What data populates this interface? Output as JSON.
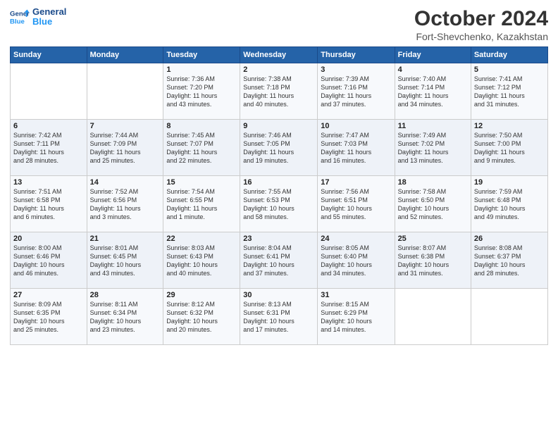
{
  "header": {
    "logo_line1": "General",
    "logo_line2": "Blue",
    "month_title": "October 2024",
    "location": "Fort-Shevchenko, Kazakhstan"
  },
  "weekdays": [
    "Sunday",
    "Monday",
    "Tuesday",
    "Wednesday",
    "Thursday",
    "Friday",
    "Saturday"
  ],
  "weeks": [
    [
      {
        "day": "",
        "info": ""
      },
      {
        "day": "",
        "info": ""
      },
      {
        "day": "1",
        "info": "Sunrise: 7:36 AM\nSunset: 7:20 PM\nDaylight: 11 hours\nand 43 minutes."
      },
      {
        "day": "2",
        "info": "Sunrise: 7:38 AM\nSunset: 7:18 PM\nDaylight: 11 hours\nand 40 minutes."
      },
      {
        "day": "3",
        "info": "Sunrise: 7:39 AM\nSunset: 7:16 PM\nDaylight: 11 hours\nand 37 minutes."
      },
      {
        "day": "4",
        "info": "Sunrise: 7:40 AM\nSunset: 7:14 PM\nDaylight: 11 hours\nand 34 minutes."
      },
      {
        "day": "5",
        "info": "Sunrise: 7:41 AM\nSunset: 7:12 PM\nDaylight: 11 hours\nand 31 minutes."
      }
    ],
    [
      {
        "day": "6",
        "info": "Sunrise: 7:42 AM\nSunset: 7:11 PM\nDaylight: 11 hours\nand 28 minutes."
      },
      {
        "day": "7",
        "info": "Sunrise: 7:44 AM\nSunset: 7:09 PM\nDaylight: 11 hours\nand 25 minutes."
      },
      {
        "day": "8",
        "info": "Sunrise: 7:45 AM\nSunset: 7:07 PM\nDaylight: 11 hours\nand 22 minutes."
      },
      {
        "day": "9",
        "info": "Sunrise: 7:46 AM\nSunset: 7:05 PM\nDaylight: 11 hours\nand 19 minutes."
      },
      {
        "day": "10",
        "info": "Sunrise: 7:47 AM\nSunset: 7:03 PM\nDaylight: 11 hours\nand 16 minutes."
      },
      {
        "day": "11",
        "info": "Sunrise: 7:49 AM\nSunset: 7:02 PM\nDaylight: 11 hours\nand 13 minutes."
      },
      {
        "day": "12",
        "info": "Sunrise: 7:50 AM\nSunset: 7:00 PM\nDaylight: 11 hours\nand 9 minutes."
      }
    ],
    [
      {
        "day": "13",
        "info": "Sunrise: 7:51 AM\nSunset: 6:58 PM\nDaylight: 11 hours\nand 6 minutes."
      },
      {
        "day": "14",
        "info": "Sunrise: 7:52 AM\nSunset: 6:56 PM\nDaylight: 11 hours\nand 3 minutes."
      },
      {
        "day": "15",
        "info": "Sunrise: 7:54 AM\nSunset: 6:55 PM\nDaylight: 11 hours\nand 1 minute."
      },
      {
        "day": "16",
        "info": "Sunrise: 7:55 AM\nSunset: 6:53 PM\nDaylight: 10 hours\nand 58 minutes."
      },
      {
        "day": "17",
        "info": "Sunrise: 7:56 AM\nSunset: 6:51 PM\nDaylight: 10 hours\nand 55 minutes."
      },
      {
        "day": "18",
        "info": "Sunrise: 7:58 AM\nSunset: 6:50 PM\nDaylight: 10 hours\nand 52 minutes."
      },
      {
        "day": "19",
        "info": "Sunrise: 7:59 AM\nSunset: 6:48 PM\nDaylight: 10 hours\nand 49 minutes."
      }
    ],
    [
      {
        "day": "20",
        "info": "Sunrise: 8:00 AM\nSunset: 6:46 PM\nDaylight: 10 hours\nand 46 minutes."
      },
      {
        "day": "21",
        "info": "Sunrise: 8:01 AM\nSunset: 6:45 PM\nDaylight: 10 hours\nand 43 minutes."
      },
      {
        "day": "22",
        "info": "Sunrise: 8:03 AM\nSunset: 6:43 PM\nDaylight: 10 hours\nand 40 minutes."
      },
      {
        "day": "23",
        "info": "Sunrise: 8:04 AM\nSunset: 6:41 PM\nDaylight: 10 hours\nand 37 minutes."
      },
      {
        "day": "24",
        "info": "Sunrise: 8:05 AM\nSunset: 6:40 PM\nDaylight: 10 hours\nand 34 minutes."
      },
      {
        "day": "25",
        "info": "Sunrise: 8:07 AM\nSunset: 6:38 PM\nDaylight: 10 hours\nand 31 minutes."
      },
      {
        "day": "26",
        "info": "Sunrise: 8:08 AM\nSunset: 6:37 PM\nDaylight: 10 hours\nand 28 minutes."
      }
    ],
    [
      {
        "day": "27",
        "info": "Sunrise: 8:09 AM\nSunset: 6:35 PM\nDaylight: 10 hours\nand 25 minutes."
      },
      {
        "day": "28",
        "info": "Sunrise: 8:11 AM\nSunset: 6:34 PM\nDaylight: 10 hours\nand 23 minutes."
      },
      {
        "day": "29",
        "info": "Sunrise: 8:12 AM\nSunset: 6:32 PM\nDaylight: 10 hours\nand 20 minutes."
      },
      {
        "day": "30",
        "info": "Sunrise: 8:13 AM\nSunset: 6:31 PM\nDaylight: 10 hours\nand 17 minutes."
      },
      {
        "day": "31",
        "info": "Sunrise: 8:15 AM\nSunset: 6:29 PM\nDaylight: 10 hours\nand 14 minutes."
      },
      {
        "day": "",
        "info": ""
      },
      {
        "day": "",
        "info": ""
      }
    ]
  ]
}
